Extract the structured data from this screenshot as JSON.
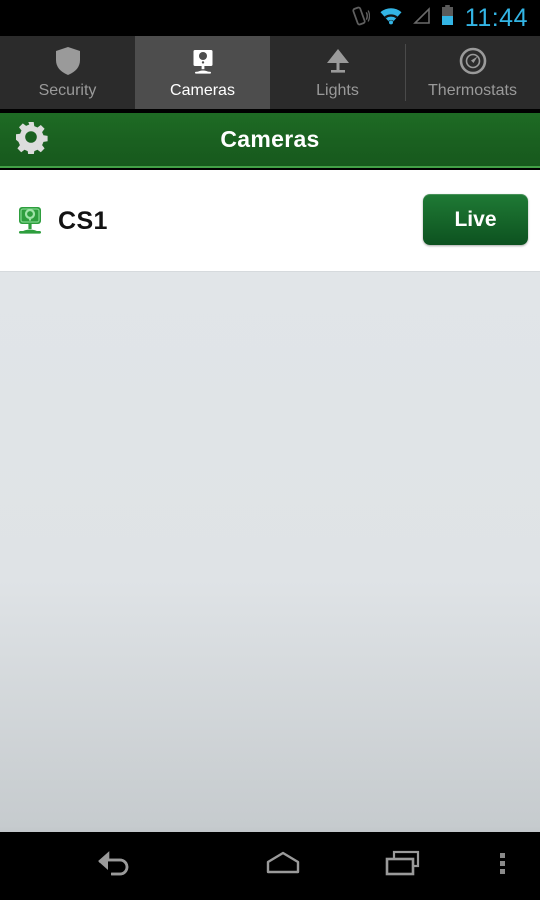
{
  "statusbar": {
    "time": "11:44",
    "icons": [
      "vibrate-icon",
      "wifi-icon",
      "cellular-signal-icon",
      "battery-icon"
    ],
    "time_color": "#33b5e5"
  },
  "tabs": [
    {
      "label": "Security",
      "icon": "shield-icon",
      "active": false
    },
    {
      "label": "Cameras",
      "icon": "camera-icon",
      "active": true
    },
    {
      "label": "Lights",
      "icon": "lamp-icon",
      "active": false
    },
    {
      "label": "Thermostats",
      "icon": "thermostat-icon",
      "active": false
    }
  ],
  "header": {
    "title": "Cameras",
    "settings_icon": "gear-icon",
    "bg_color": "#1a6020",
    "accent_color": "#43a047"
  },
  "camera_list": [
    {
      "name": "CS1",
      "icon": "camera-device-icon",
      "button_label": "Live"
    }
  ],
  "navbar": {
    "back_label": "Back",
    "home_label": "Home",
    "recents_label": "Recent apps",
    "menu_label": "Menu"
  }
}
